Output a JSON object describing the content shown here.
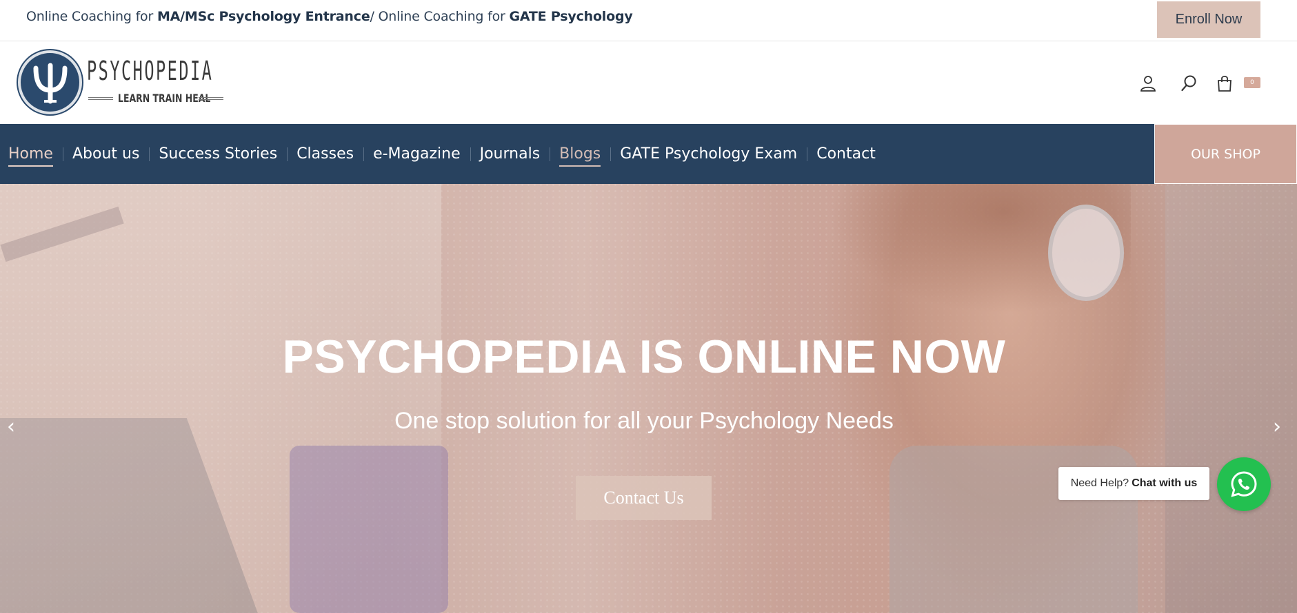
{
  "topbar": {
    "ticker": {
      "part1": "Online Coaching for ",
      "bold1": "MA/MSc Psychology Entrance",
      "part2": "/ Online Coaching for ",
      "bold2": "GATE Psychology"
    },
    "enroll_label": "Enroll Now"
  },
  "header": {
    "logo_name": "PSYCHOPEDIA",
    "logo_tagline": "LEARN TRAIN HEAL",
    "icons": [
      "user-icon",
      "search-icon",
      "cart-icon"
    ],
    "cart_count": "0"
  },
  "nav": {
    "items": [
      {
        "label": "Home"
      },
      {
        "label": "About us"
      },
      {
        "label": "Success Stories"
      },
      {
        "label": "Classes"
      },
      {
        "label": "e-Magazine"
      },
      {
        "label": "Journals"
      },
      {
        "label": "Blogs"
      },
      {
        "label": "GATE Psychology Exam"
      },
      {
        "label": "Contact"
      }
    ],
    "shop_label": "OUR SHOP"
  },
  "hero": {
    "title": "PSYCHOPEDIA IS ONLINE NOW",
    "subtitle": "One stop solution for all your Psychology Needs",
    "cta_label": "Contact Us",
    "prev_arrow": "‹",
    "next_arrow": "›"
  },
  "chat": {
    "prefix": "Need Help?",
    "bold": "Chat with us"
  },
  "colors": {
    "nav_bg": "#28425f",
    "accent": "#cfa69a",
    "whatsapp": "#23c050"
  }
}
